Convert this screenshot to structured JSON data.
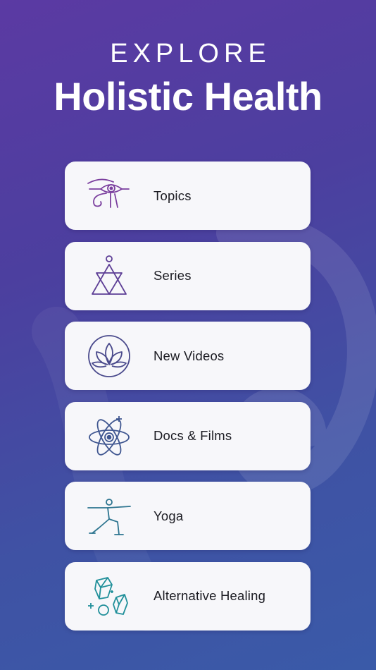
{
  "header": {
    "eyebrow": "EXPLORE",
    "title": "Holistic Health"
  },
  "menu": {
    "items": [
      {
        "label": "Topics",
        "icon": "eye-of-horus-icon",
        "color": "#7b3f9e"
      },
      {
        "label": "Series",
        "icon": "triangles-icon",
        "color": "#5e3f96"
      },
      {
        "label": "New Videos",
        "icon": "lotus-icon",
        "color": "#4a4a8c"
      },
      {
        "label": "Docs & Films",
        "icon": "atom-eye-icon",
        "color": "#3f5690"
      },
      {
        "label": "Yoga",
        "icon": "yoga-pose-icon",
        "color": "#2e7590"
      },
      {
        "label": "Alternative Healing",
        "icon": "crystals-icon",
        "color": "#21909a"
      }
    ]
  }
}
